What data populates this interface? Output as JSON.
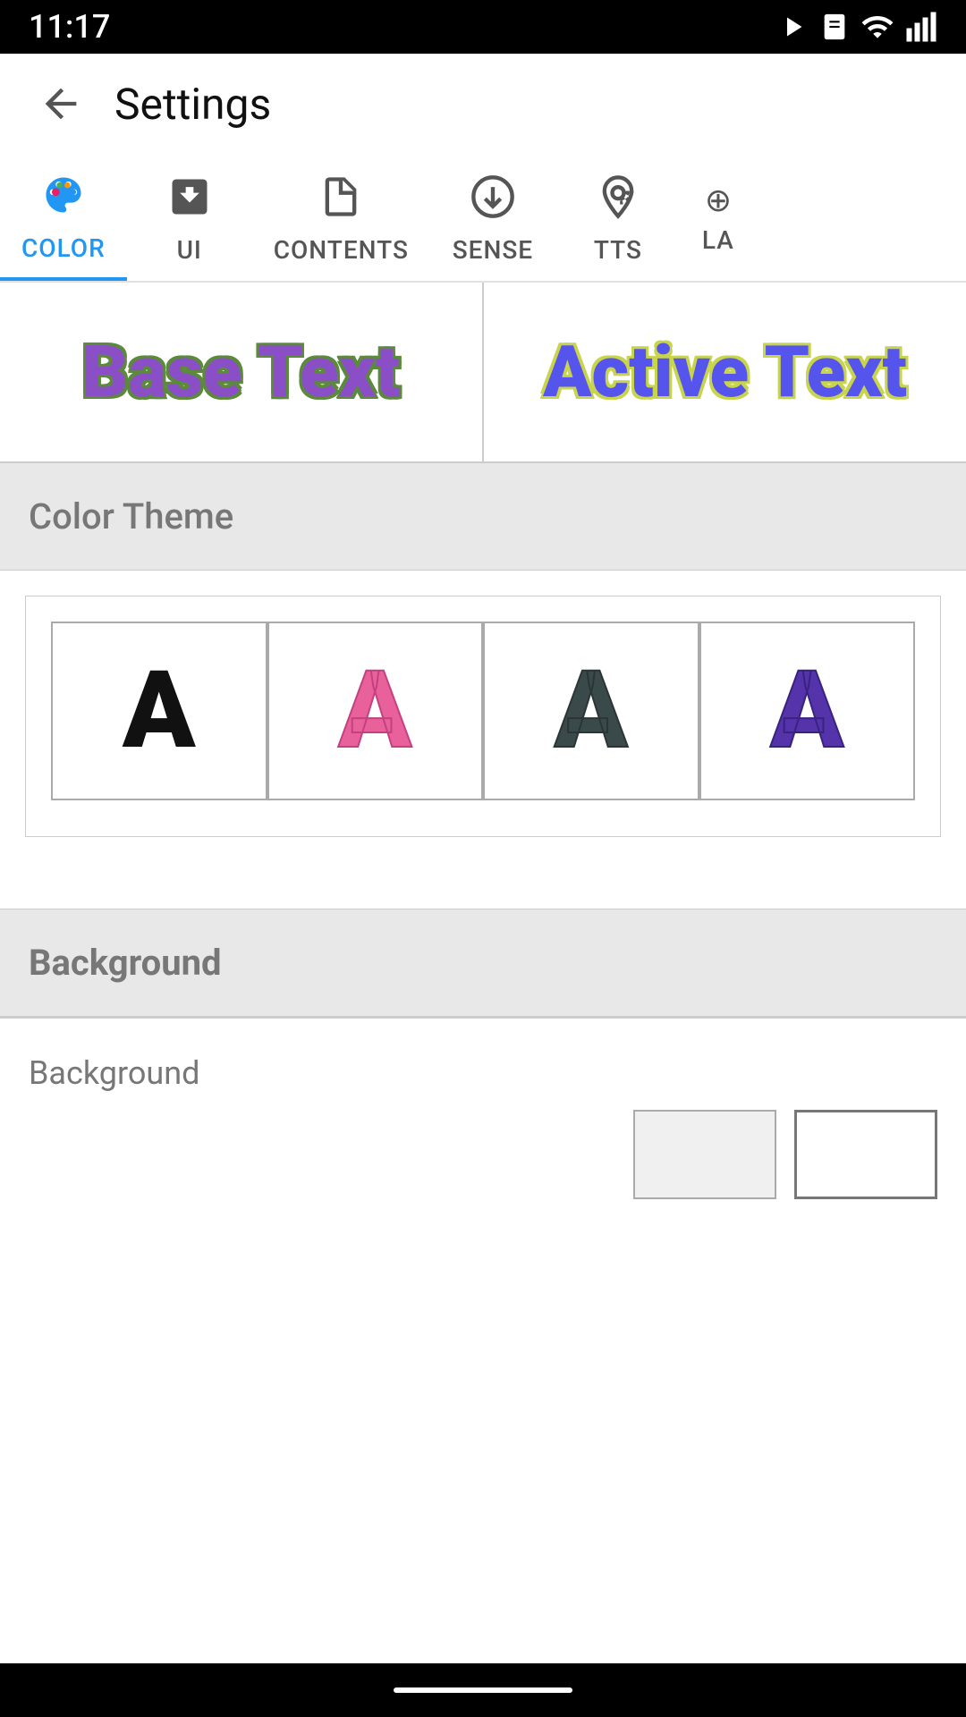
{
  "status_bar": {
    "time": "11:17",
    "icons": [
      "play",
      "sim",
      "wifi",
      "signal"
    ]
  },
  "toolbar": {
    "back_label": "←",
    "title": "Settings"
  },
  "tabs": [
    {
      "id": "color",
      "label": "COLOR",
      "icon": "🎨",
      "active": true
    },
    {
      "id": "ui",
      "label": "UI",
      "icon": "⬇□",
      "active": false
    },
    {
      "id": "contents",
      "label": "CONTENTS",
      "icon": "📄",
      "active": false
    },
    {
      "id": "sense",
      "label": "SENSE",
      "icon": "⊙",
      "active": false
    },
    {
      "id": "tts",
      "label": "TTS",
      "icon": "📡",
      "active": false
    },
    {
      "id": "la",
      "label": "LA",
      "icon": "...",
      "active": false
    }
  ],
  "preview": {
    "base_text": "Base Text",
    "active_text": "Active Text"
  },
  "color_theme": {
    "section_label": "Color Theme",
    "options": [
      {
        "id": "black",
        "letter": "A"
      },
      {
        "id": "pink",
        "letter": "A"
      },
      {
        "id": "dark",
        "letter": "A"
      },
      {
        "id": "purple",
        "letter": "A"
      }
    ]
  },
  "background": {
    "section_label": "Background",
    "row_label": "Background",
    "swatches": [
      {
        "id": "swatch1",
        "color": "#f0f0f0"
      },
      {
        "id": "swatch2",
        "color": "#ffffff"
      }
    ]
  },
  "nav_bar": {
    "indicator": "─"
  }
}
